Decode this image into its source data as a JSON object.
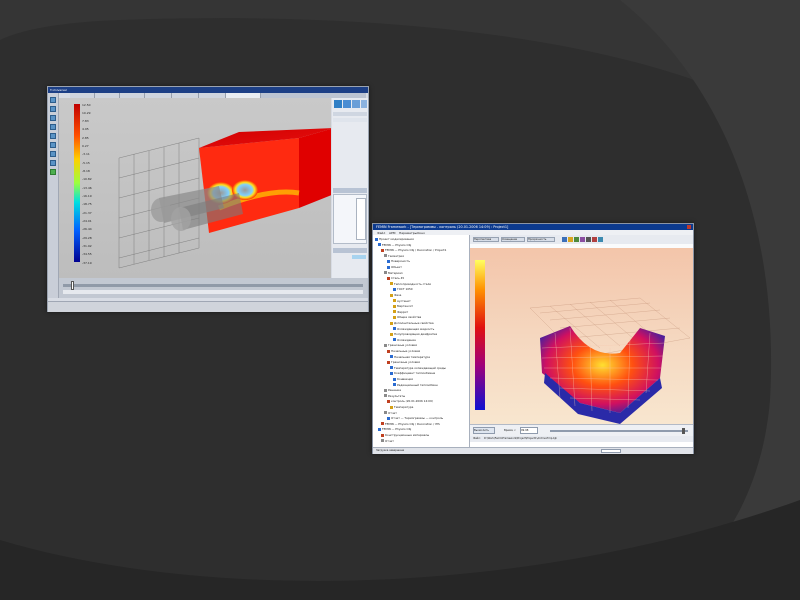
{
  "window_left": {
    "title": "T-Universal",
    "colorbar_ticks": [
      "12.50",
      "10.29",
      "7.83",
      "4.95",
      "2.85",
      "0.27",
      "-3.11",
      "-5.15",
      "-8.18",
      "-10.82",
      "-13.46",
      "-16.19",
      "-18.75",
      "-21.37",
      "-24.01",
      "-26.44",
      "-29.28",
      "-31.92",
      "-34.55",
      "-37.19"
    ],
    "right_panel_items": [
      "",
      "",
      "",
      ""
    ],
    "status_text": ""
  },
  "window_right": {
    "title": "FEMIN Framework - [Термограммы - контроль (20.01.2006 14:09) : Project1]",
    "menu": [
      "Файл",
      "АРМ",
      "Параметры",
      "Окно"
    ],
    "toolbar_tabs": [
      "Перспектива",
      "Освещение",
      "Прозрачность"
    ],
    "tree": [
      {
        "text": "Проект моделирования",
        "indent": 0,
        "color": "#2a6bd1"
      },
      {
        "text": "FEMIN — Physics Obj",
        "indent": 1,
        "color": "#2a6bd1"
      },
      {
        "text": "FEMIN — Physics Obj / Decoration / Project1",
        "indent": 2,
        "color": "#c04020"
      },
      {
        "text": "Геометрия",
        "indent": 3,
        "color": "#8a8a8a"
      },
      {
        "text": "Поверхность",
        "indent": 4,
        "color": "#2a6bd1"
      },
      {
        "text": "Объект",
        "indent": 4,
        "color": "#2a6bd1"
      },
      {
        "text": "Материал",
        "indent": 3,
        "color": "#8a8a8a"
      },
      {
        "text": "Сталь 45",
        "indent": 4,
        "color": "#c04020"
      },
      {
        "text": "Теплопроводность стали",
        "indent": 5,
        "color": "#d4a017"
      },
      {
        "text": "ГОСТ 1050",
        "indent": 6,
        "color": "#2a6bd1"
      },
      {
        "text": "Фаза",
        "indent": 5,
        "color": "#d4a017"
      },
      {
        "text": "Аустенит",
        "indent": 6,
        "color": "#d4a017"
      },
      {
        "text": "Мартенсит",
        "indent": 6,
        "color": "#d4a017"
      },
      {
        "text": "Феррит",
        "indent": 6,
        "color": "#d4a017"
      },
      {
        "text": "Общие свойства",
        "indent": 6,
        "color": "#d4a017"
      },
      {
        "text": "Дополнительные свойства",
        "indent": 5,
        "color": "#d4a017"
      },
      {
        "text": "Охлаждающая жидкость",
        "indent": 6,
        "color": "#2a6bd1"
      },
      {
        "text": "Полупроводящая диафрагма",
        "indent": 5,
        "color": "#d4a017"
      },
      {
        "text": "Охлаждение",
        "indent": 6,
        "color": "#2a6bd1"
      },
      {
        "text": "Граничные условия",
        "indent": 3,
        "color": "#8a8a8a"
      },
      {
        "text": "Начальные условия",
        "indent": 4,
        "color": "#c04020"
      },
      {
        "text": "Начальная температура",
        "indent": 5,
        "color": "#2a6bd1"
      },
      {
        "text": "Граничные условия",
        "indent": 4,
        "color": "#c04020"
      },
      {
        "text": "Температура охлаждающей среды",
        "indent": 5,
        "color": "#2a6bd1"
      },
      {
        "text": "Коэффициент теплообмена",
        "indent": 5,
        "color": "#2a6bd1"
      },
      {
        "text": "Конвекция",
        "indent": 6,
        "color": "#2a6bd1"
      },
      {
        "text": "Радиационный теплообмен",
        "indent": 6,
        "color": "#2a6bd1"
      },
      {
        "text": "Решение",
        "indent": 3,
        "color": "#8a8a8a"
      },
      {
        "text": "Результаты",
        "indent": 3,
        "color": "#8a8a8a"
      },
      {
        "text": "контроль (20.01.2006 14:09)",
        "indent": 4,
        "color": "#c04020"
      },
      {
        "text": "Температура",
        "indent": 5,
        "color": "#d4a017"
      },
      {
        "text": "Отчет",
        "indent": 3,
        "color": "#8a8a8a"
      },
      {
        "text": "Отчет — Термограммы — контроль",
        "indent": 4,
        "color": "#2a6bd1"
      },
      {
        "text": "FEMIN — Physics Obj / Decoration / IHS",
        "indent": 2,
        "color": "#c04020"
      },
      {
        "text": "FEMIN — Physics Obj",
        "indent": 1,
        "color": "#2a6bd1"
      },
      {
        "text": "Конструкционные материалы",
        "indent": 2,
        "color": "#c04020"
      },
      {
        "text": "Отчет",
        "indent": 2,
        "color": "#8a8a8a"
      }
    ],
    "time_label": "Время, с",
    "time_value": "99.98",
    "path_label": "Файл:",
    "path_value": "D:\\Work\\FemInFramework\\Project\\Project1\\ArchiveTmp.bjk",
    "status_text": "Загрузка завершена",
    "button_labels": [
      "Вычислить",
      "Обновить"
    ]
  },
  "colors": {
    "background": "#2e2e2e",
    "swoosh": "#3b3b3b",
    "titlebar_left": "#1c3f86",
    "titlebar_right": "#0c3a8e"
  }
}
